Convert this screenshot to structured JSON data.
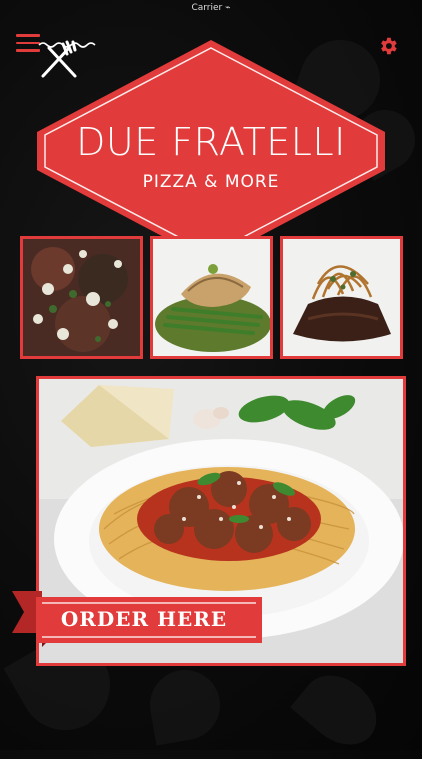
{
  "status_bar": {
    "text": "Carrier ⌁"
  },
  "brand": {
    "title": "DUE FRATELLI",
    "subtitle": "PIZZA & MORE",
    "accent_color": "#e23b3b"
  },
  "header": {
    "menu_icon": "hamburger-icon",
    "settings_icon": "gear-icon"
  },
  "gallery": {
    "items": [
      {
        "name": "steak-salad",
        "icon": "food-photo"
      },
      {
        "name": "fish-asparagus",
        "icon": "food-photo"
      },
      {
        "name": "short-rib-onion-strings",
        "icon": "food-photo"
      }
    ]
  },
  "hero": {
    "name": "spaghetti-meatballs",
    "icon": "food-photo"
  },
  "order": {
    "label": "ORDER HERE"
  }
}
